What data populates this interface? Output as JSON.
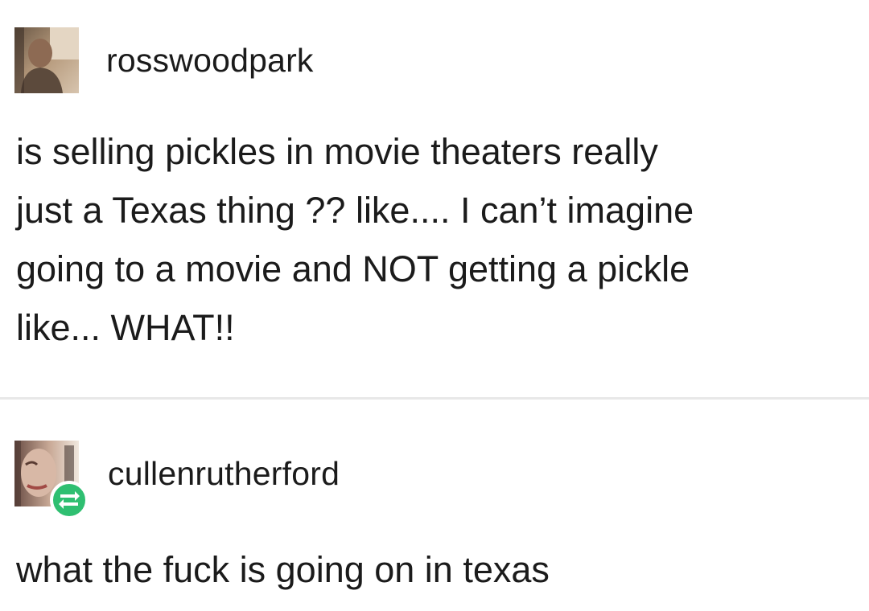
{
  "posts": [
    {
      "username": "rosswoodpark",
      "avatar_icon": "user-avatar",
      "body_lines": [
        "is selling pickles in movie theaters really",
        "just a Texas thing ?? like.... I can’t imagine",
        "going to a movie and NOT getting a pickle",
        "like... WHAT!!"
      ]
    },
    {
      "username": "cullenrutherford",
      "avatar_icon": "user-avatar",
      "badge_icon": "reblog-icon",
      "body_lines": [
        "what the fuck is going on in texas"
      ]
    }
  ],
  "colors": {
    "text": "#1b1b1b",
    "divider": "#e8e8e8",
    "reblog_badge": "#2fbf71",
    "background": "#ffffff"
  }
}
